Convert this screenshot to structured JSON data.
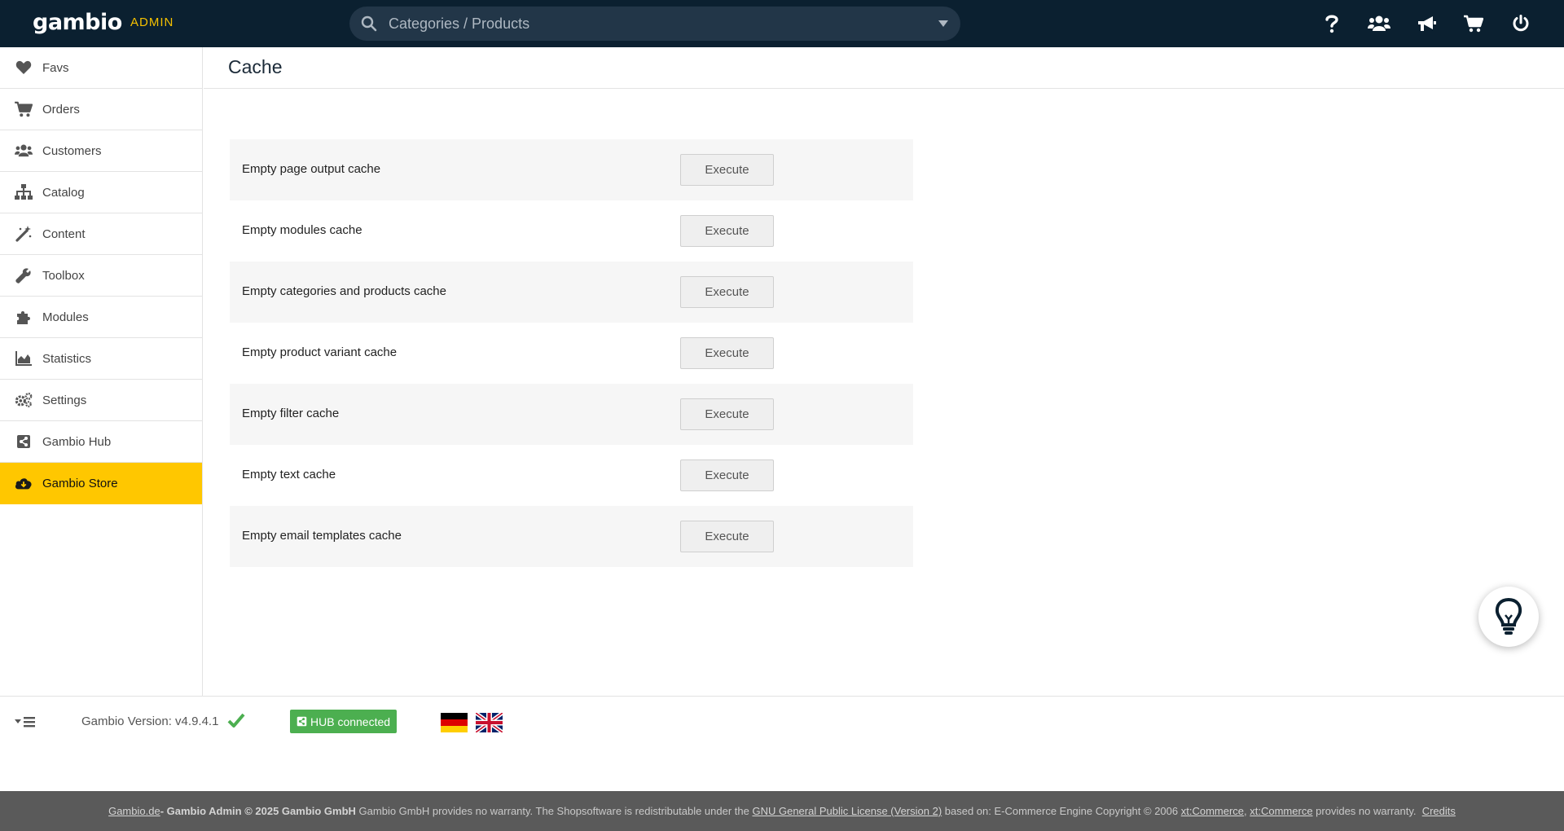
{
  "header": {
    "logo": "gambio",
    "logo_sub": "ADMIN",
    "search_placeholder": "Categories / Products",
    "icons": [
      "help-icon",
      "users-icon",
      "megaphone-icon",
      "cart-icon",
      "power-icon"
    ]
  },
  "sidebar": {
    "items": [
      {
        "label": "Favs",
        "icon": "heart-icon"
      },
      {
        "label": "Orders",
        "icon": "cart-icon"
      },
      {
        "label": "Customers",
        "icon": "users-icon"
      },
      {
        "label": "Catalog",
        "icon": "sitemap-icon"
      },
      {
        "label": "Content",
        "icon": "magic-wand-icon"
      },
      {
        "label": "Toolbox",
        "icon": "wrench-icon"
      },
      {
        "label": "Modules",
        "icon": "puzzle-icon"
      },
      {
        "label": "Statistics",
        "icon": "area-chart-icon"
      },
      {
        "label": "Settings",
        "icon": "cogs-icon"
      },
      {
        "label": "Gambio Hub",
        "icon": "share-square-icon"
      },
      {
        "label": "Gambio Store",
        "icon": "cloud-download-icon",
        "active": true
      }
    ]
  },
  "page": {
    "title": "Cache",
    "rows": [
      {
        "label": "Empty page output cache",
        "button": "Execute"
      },
      {
        "label": "Empty modules cache",
        "button": "Execute"
      },
      {
        "label": "Empty categories and products cache",
        "button": "Execute"
      },
      {
        "label": "Empty product variant cache",
        "button": "Execute"
      },
      {
        "label": "Empty filter cache",
        "button": "Execute"
      },
      {
        "label": "Empty text cache",
        "button": "Execute"
      },
      {
        "label": "Empty email templates cache",
        "button": "Execute"
      }
    ]
  },
  "status": {
    "version": "Gambio Version: v4.9.4.1",
    "hub": "HUB connected",
    "flags": [
      "de-flag",
      "uk-flag"
    ]
  },
  "footer": {
    "gambio_link": "Gambio.de",
    "copyright": " - Gambio Admin © 2025 Gambio GmbH",
    "text1": " Gambio GmbH provides no warranty. The Shopsoftware is redistributable under the ",
    "gpl_link": "GNU General Public License (Version 2)",
    "text2": " based on: E-Commerce Engine Copyright © 2006 ",
    "xt1": "xt:Commerce",
    "comma": ", ",
    "xt2": "xt:Commerce",
    "text3": " provides no warranty.  ",
    "credits": "Credits"
  },
  "colors": {
    "topbar": "#0b2030",
    "accent": "#ffc700",
    "hub_green": "#4caf50"
  }
}
